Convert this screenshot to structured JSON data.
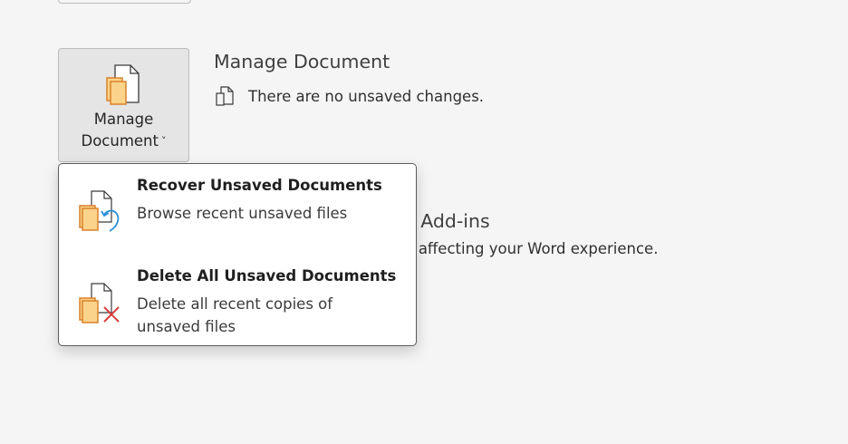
{
  "manage_button": {
    "line1": "Manage",
    "line2": "Document",
    "chevron": "˅"
  },
  "section": {
    "title": "Manage Document",
    "status": "There are no unsaved changes."
  },
  "background": {
    "addins_title": "M Add-ins",
    "addins_desc": "re affecting your Word experience."
  },
  "menu": {
    "items": [
      {
        "title": "Recover Unsaved Documents",
        "desc": "Browse recent unsaved files",
        "icon": "recover-document-icon"
      },
      {
        "title": "Delete All Unsaved Documents",
        "desc": "Delete all recent copies of unsaved files",
        "icon": "delete-document-icon"
      }
    ]
  },
  "colors": {
    "doc_orange": "#e8a33d",
    "doc_fill": "#fbd38a",
    "recover_blue": "#2b8fd8",
    "delete_red": "#d83b3b"
  }
}
